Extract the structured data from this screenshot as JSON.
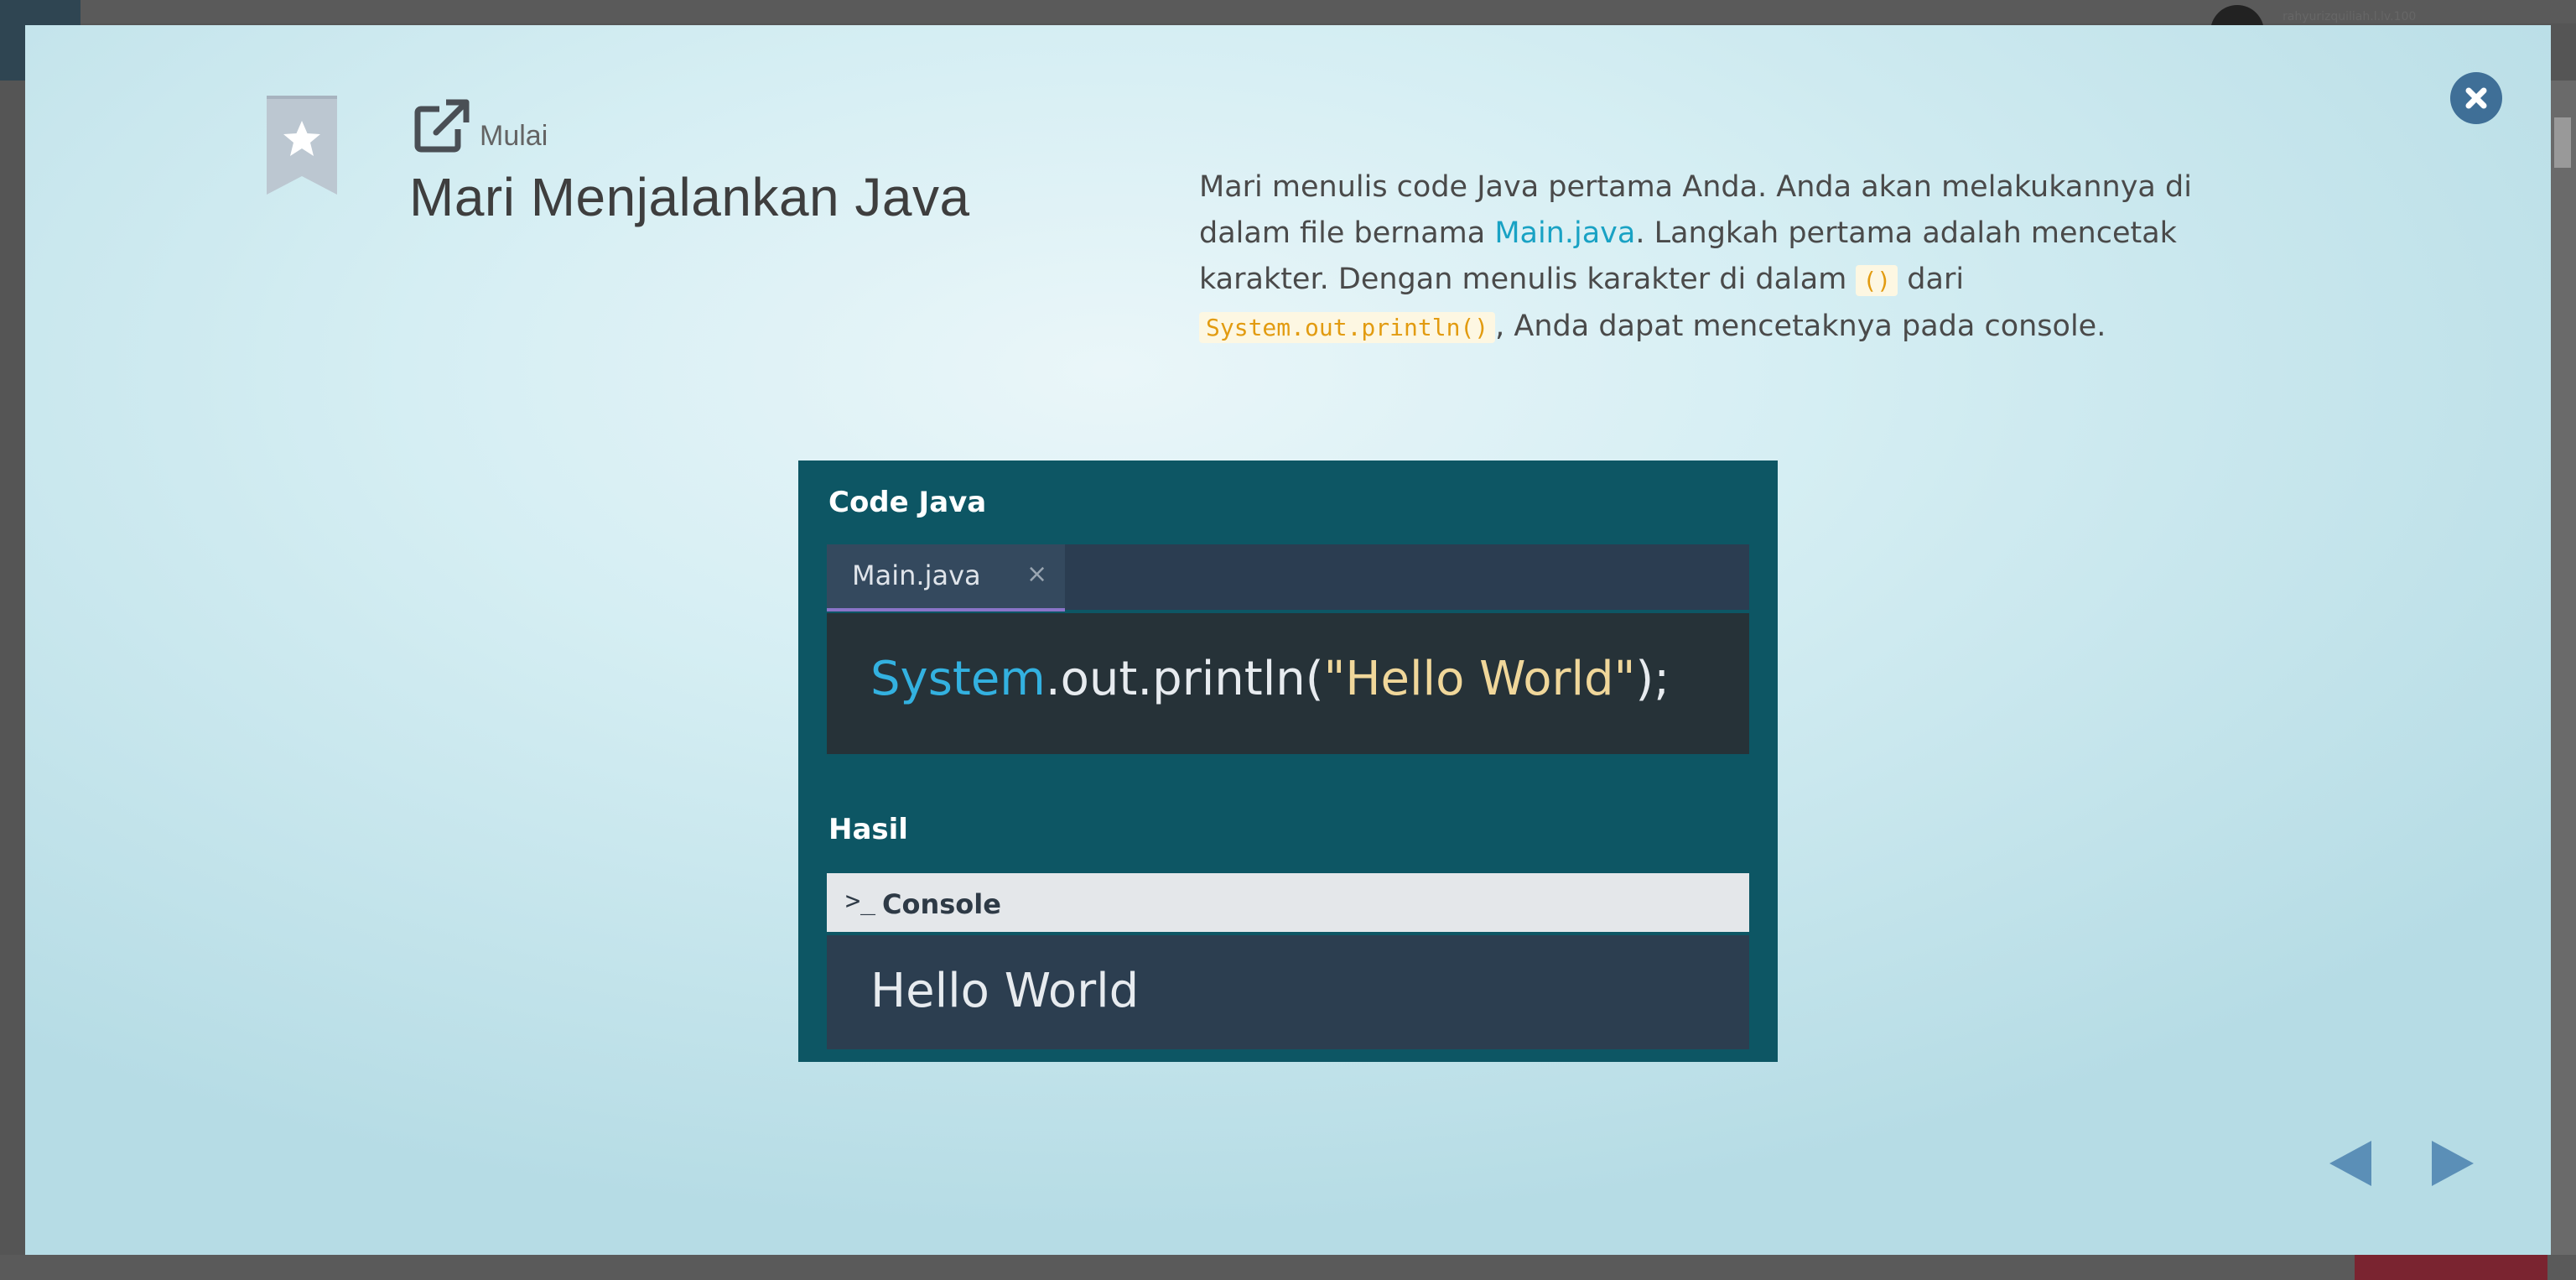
{
  "app": {
    "user_name": "rahyurizquiliah.l.lv.100"
  },
  "lesson": {
    "start_label": "Mulai",
    "title": "Mari Menjalankan Java",
    "description": {
      "p1": "Mari menulis code Java pertama Anda. Anda akan melakukannya di dalam file bernama ",
      "link": "Main.java",
      "p2": ". Langkah pertama adalah mencetak karakter. Dengan menulis karakter di dalam ",
      "code1": "()",
      "p3": " dari ",
      "code2": "System.out.println()",
      "p4": ", Anda dapat mencetaknya pada console."
    }
  },
  "illustration": {
    "code_heading": "Code Java",
    "tab_label": "Main.java",
    "tab_close": "×",
    "code": {
      "cls": "System",
      "mid": ".out.println(",
      "str": "\"Hello World\"",
      "end": ");"
    },
    "result_heading": "Hasil",
    "console_glyph": ">_",
    "console_label": "Console",
    "output": "Hello World"
  },
  "controls": {
    "close_icon": "close-icon",
    "prev_icon": "triangle-left-icon",
    "next_icon": "triangle-right-icon"
  },
  "colors": {
    "accent": "#19a2c4",
    "close_button": "#3f6f97",
    "nav_arrows": "#5b8fb7",
    "code_chip_text": "#e29b10",
    "illustration_bg": "#0d5664"
  }
}
